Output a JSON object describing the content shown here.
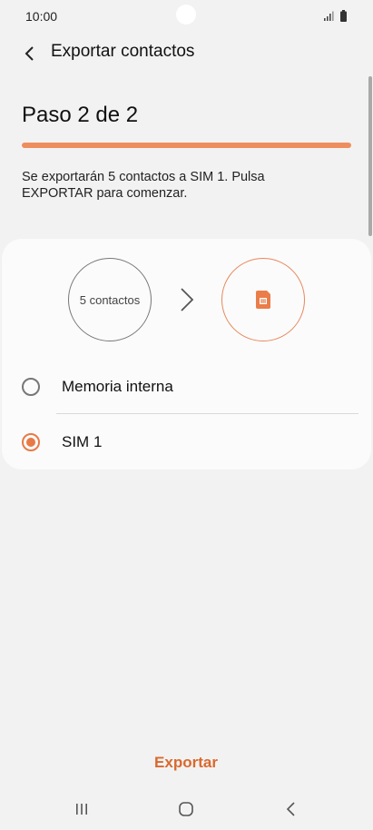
{
  "status_bar": {
    "time": "10:00",
    "icons": [
      "camera-cutout",
      "signal-icon",
      "battery-icon"
    ]
  },
  "header": {
    "back_icon": "chevron-left-icon",
    "title": "Exportar contactos"
  },
  "step": {
    "label": "Paso 2 de 2",
    "progress": 1.0
  },
  "description": "Se exportarán 5 contactos a SIM 1. Pulsa EXPORTAR para comenzar.",
  "transfer": {
    "source_label": "5 contactos",
    "arrow_icon": "chevron-right-icon",
    "target_icon": "sim-card-icon"
  },
  "options": [
    {
      "label": "Memoria interna",
      "selected": false
    },
    {
      "label": "SIM 1",
      "selected": true
    }
  ],
  "actions": {
    "export_label": "Exportar"
  },
  "nav_bar": {
    "icons": [
      "recents-icon",
      "home-icon",
      "back-icon"
    ]
  },
  "colors": {
    "accent": "#e87a46",
    "progress": "#ef8e5d",
    "background": "#f2f2f2",
    "card": "#fbfbfb"
  }
}
